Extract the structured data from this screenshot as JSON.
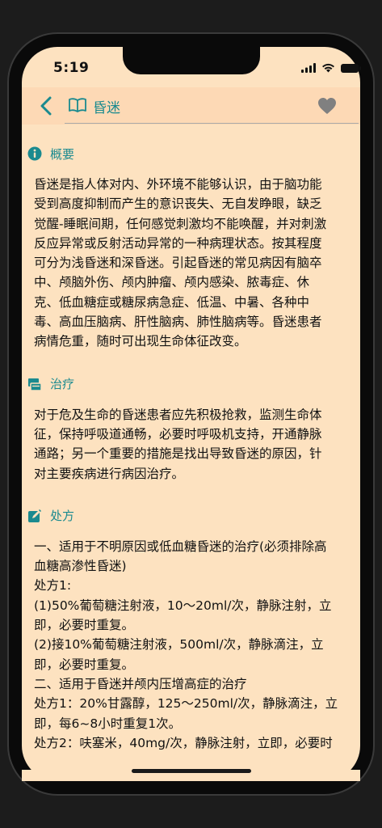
{
  "status_bar": {
    "time": "5:19",
    "icons": [
      "signal-icon",
      "wifi-icon",
      "battery-icon"
    ]
  },
  "nav": {
    "title": "昏迷",
    "back_icon": "chevron-left-icon",
    "title_icon": "book-icon",
    "favorite_icon": "heart-icon"
  },
  "colors": {
    "accent": "#1a8a8f",
    "background": "#fde2c0",
    "text": "#111111"
  },
  "sections": {
    "overview": {
      "icon": "info-icon",
      "title": "概要",
      "lines": [
        "昏迷是指人体对内、外环境不能够认识，由于脑功能",
        "受到高度抑制而产生的意识丧失、无自发睁眼，缺乏",
        "觉醒-睡眠间期，任何感觉刺激均不能唤醒，并对刺激",
        "反应异常或反射活动异常的一种病理状态。按其程度",
        "可分为浅昏迷和深昏迷。引起昏迷的常见病因有脑卒",
        "中、颅脑外伤、颅内肿瘤、颅内感染、脓毒症、休",
        "克、低血糖症或糖尿病急症、低温、中暑、各种中",
        "毒、高血压脑病、肝性脑病、肺性脑病等。昏迷患者",
        "病情危重，随时可出现生命体征改变。"
      ]
    },
    "treatment": {
      "icon": "treatment-icon",
      "title": "治疗",
      "lines": [
        "对于危及生命的昏迷患者应先积极抢救，监测生命体",
        "征，保持呼吸道通畅，必要时呼吸机支持，开通静脉",
        "通路；另一个重要的措施是找出导致昏迷的原因，针",
        "对主要疾病进行病因治疗。"
      ]
    },
    "prescription": {
      "icon": "edit-icon",
      "title": "处方",
      "lines": [
        "一、适用于不明原因或低血糖昏迷的治疗(必须排除高",
        "血糖高渗性昏迷)",
        "处方1:",
        "(1)50%葡萄糖注射液，10～20ml/次，静脉注射，立",
        "即，必要时重复。",
        "(2)接10%葡萄糖注射液，500ml/次，静脉滴注，立",
        "即，必要时重复。",
        "二、适用于昏迷并颅内压增高症的治疗",
        "处方1：20%甘露醇，125～250ml/次，静脉滴注，立",
        "即，每6~8小时重复1次。",
        "处方2：呋塞米，40mg/次，静脉注射，立即，必要时"
      ]
    }
  }
}
